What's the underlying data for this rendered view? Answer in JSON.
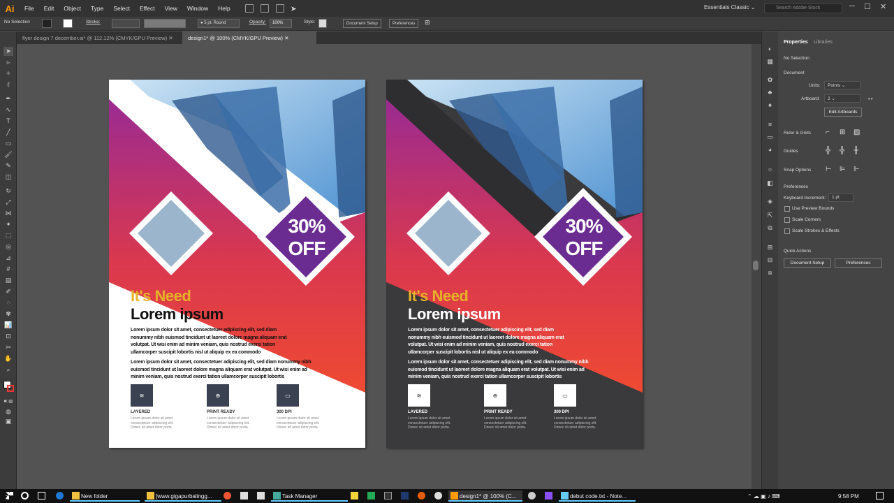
{
  "app": {
    "logo": "Ai",
    "menus": [
      "File",
      "Edit",
      "Object",
      "Type",
      "Select",
      "Effect",
      "View",
      "Window",
      "Help"
    ],
    "workspace": "Essentials Classic",
    "stock_placeholder": "Search Adobe Stock"
  },
  "control": {
    "selection": "No Selection",
    "stroke_label": "Stroke:",
    "brush": "5 pt. Round",
    "opacity_label": "Opacity:",
    "opacity": "100%",
    "style_label": "Style:",
    "doc_setup": "Document Setup",
    "preferences": "Preferences"
  },
  "tabs": [
    "flyer design 7 december.ai* @ 112.12% (CMYK/GPU Preview)",
    "design1* @ 100% (CMYK/GPU Preview)"
  ],
  "flyer": {
    "offer_pct": "30%",
    "offer_word": "OFF",
    "heading1": "It's Need",
    "heading2": "Lorem ipsum",
    "para1": "Lorem ipsum dolor sit amet, consectetuer adipiscing elit, sed diam nonummy nibh euismod tincidunt ut laoreet dolore magna aliquam erat volutpat. Ut wisi enim ad minim veniam, quis nostrud exerci tation ullamcorper suscipit lobortis nisl ut aliquip ex ea commodo",
    "para2": "Lorem ipsum dolor sit amet, consectetuer adipiscing elit, sed diam nonummy nibh euismod tincidunt ut laoreet dolore magna aliquam erat volutpat. Ut wisi enim ad minim veniam, quis nostrud exerci tation ullamcorper suscipit lobortis",
    "features": [
      {
        "title": "LAYERED",
        "desc": "Lorem ipsum dolor sit amet consectetuer adipiscing elit. Donec sit amet dolor porta."
      },
      {
        "title": "PRINT READY",
        "desc": "Lorem ipsum dolor sit amet consectetuer adipiscing elit. Donec sit amet dolor porta."
      },
      {
        "title": "300 DPI",
        "desc": "Lorem ipsum dolor sit amet consectetuer adipiscing elit. Donec sit amet dolor porta."
      }
    ]
  },
  "properties": {
    "tab1": "Properties",
    "tab2": "Libraries",
    "no_selection": "No Selection",
    "document": "Document",
    "units_label": "Units:",
    "units": "Points",
    "artboard_label": "Artboard:",
    "artboard": "2",
    "edit_artboards": "Edit Artboards",
    "ruler_grids": "Ruler & Grids",
    "guides": "Guides",
    "snap": "Snap Options",
    "prefs": "Preferences",
    "kb_label": "Keyboard Increment:",
    "kb": "1 pt",
    "preview_bounds": "Use Preview Bounds",
    "scale_corners": "Scale Corners",
    "scale_strokes": "Scale Strokes & Effects",
    "quick_actions": "Quick Actions",
    "doc_setup": "Document Setup",
    "preferences": "Preferences"
  },
  "taskbar": {
    "items": [
      "New folder",
      "[www.gigapurbalingg...",
      "Task Manager",
      "design1* @ 100% (C...",
      "debut code.txt - Note..."
    ],
    "time": "9:58 PM"
  },
  "colors": {
    "purple": "#6a2c91",
    "red": "#e8413a",
    "magenta": "#a0288f",
    "yellow": "#e6b227",
    "dark": "#3a3a3c"
  }
}
